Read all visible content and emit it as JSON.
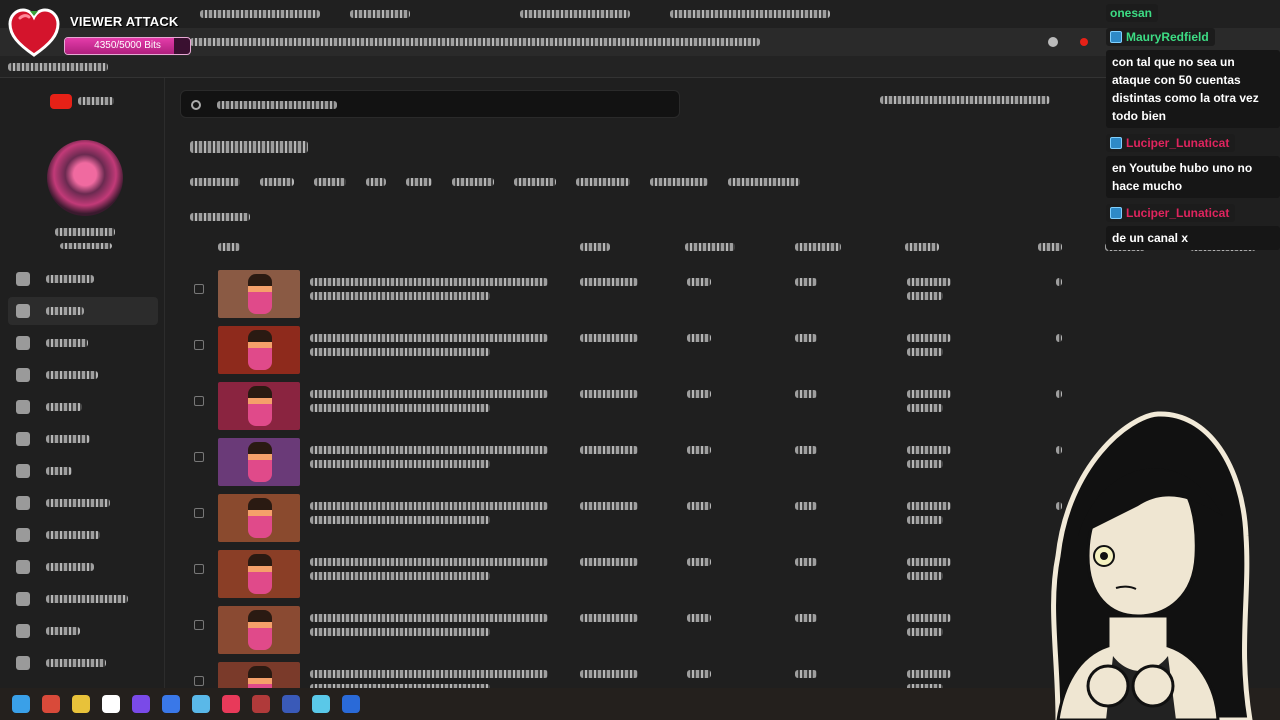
{
  "overlay": {
    "viewer_attack": {
      "title": "VIEWER ATTACK",
      "bits_text": "4350/5000 Bits",
      "bits_current": 4350,
      "bits_goal": 5000,
      "accent_color": "#d02b90"
    }
  },
  "chat": {
    "messages": [
      {
        "user": "onesan",
        "user_color": "#3ddc84",
        "text": ""
      },
      {
        "user": "MauryRedfield",
        "user_color": "#3ddc84",
        "text": "con tal que no sea un ataque con 50 cuentas distintas como la otra vez todo bien"
      },
      {
        "user": "Luciper_Lunaticat",
        "user_color": "#e0245e",
        "text": "en Youtube hubo uno no hace mucho"
      },
      {
        "user": "Luciper_Lunaticat",
        "user_color": "#e0245e",
        "text": "de un canal x"
      }
    ]
  },
  "studio": {
    "row_thumb_colors": [
      "#8a5a44",
      "#8e2a1c",
      "#8a2440",
      "#6a3a78",
      "#8a4a2e",
      "#8a3e26",
      "#8a4a32",
      "#7a3a2a"
    ],
    "sidebar_item_count": 13
  },
  "taskbar": {
    "icon_colors": [
      "#3aa0e8",
      "#d94a3a",
      "#e8c23a",
      "#ffffff",
      "#7a4ae8",
      "#3a78e8",
      "#5ab8e8",
      "#e83a5a",
      "#b03a3a",
      "#3a5ab8",
      "#5ac8e8",
      "#2a6ad8"
    ]
  }
}
